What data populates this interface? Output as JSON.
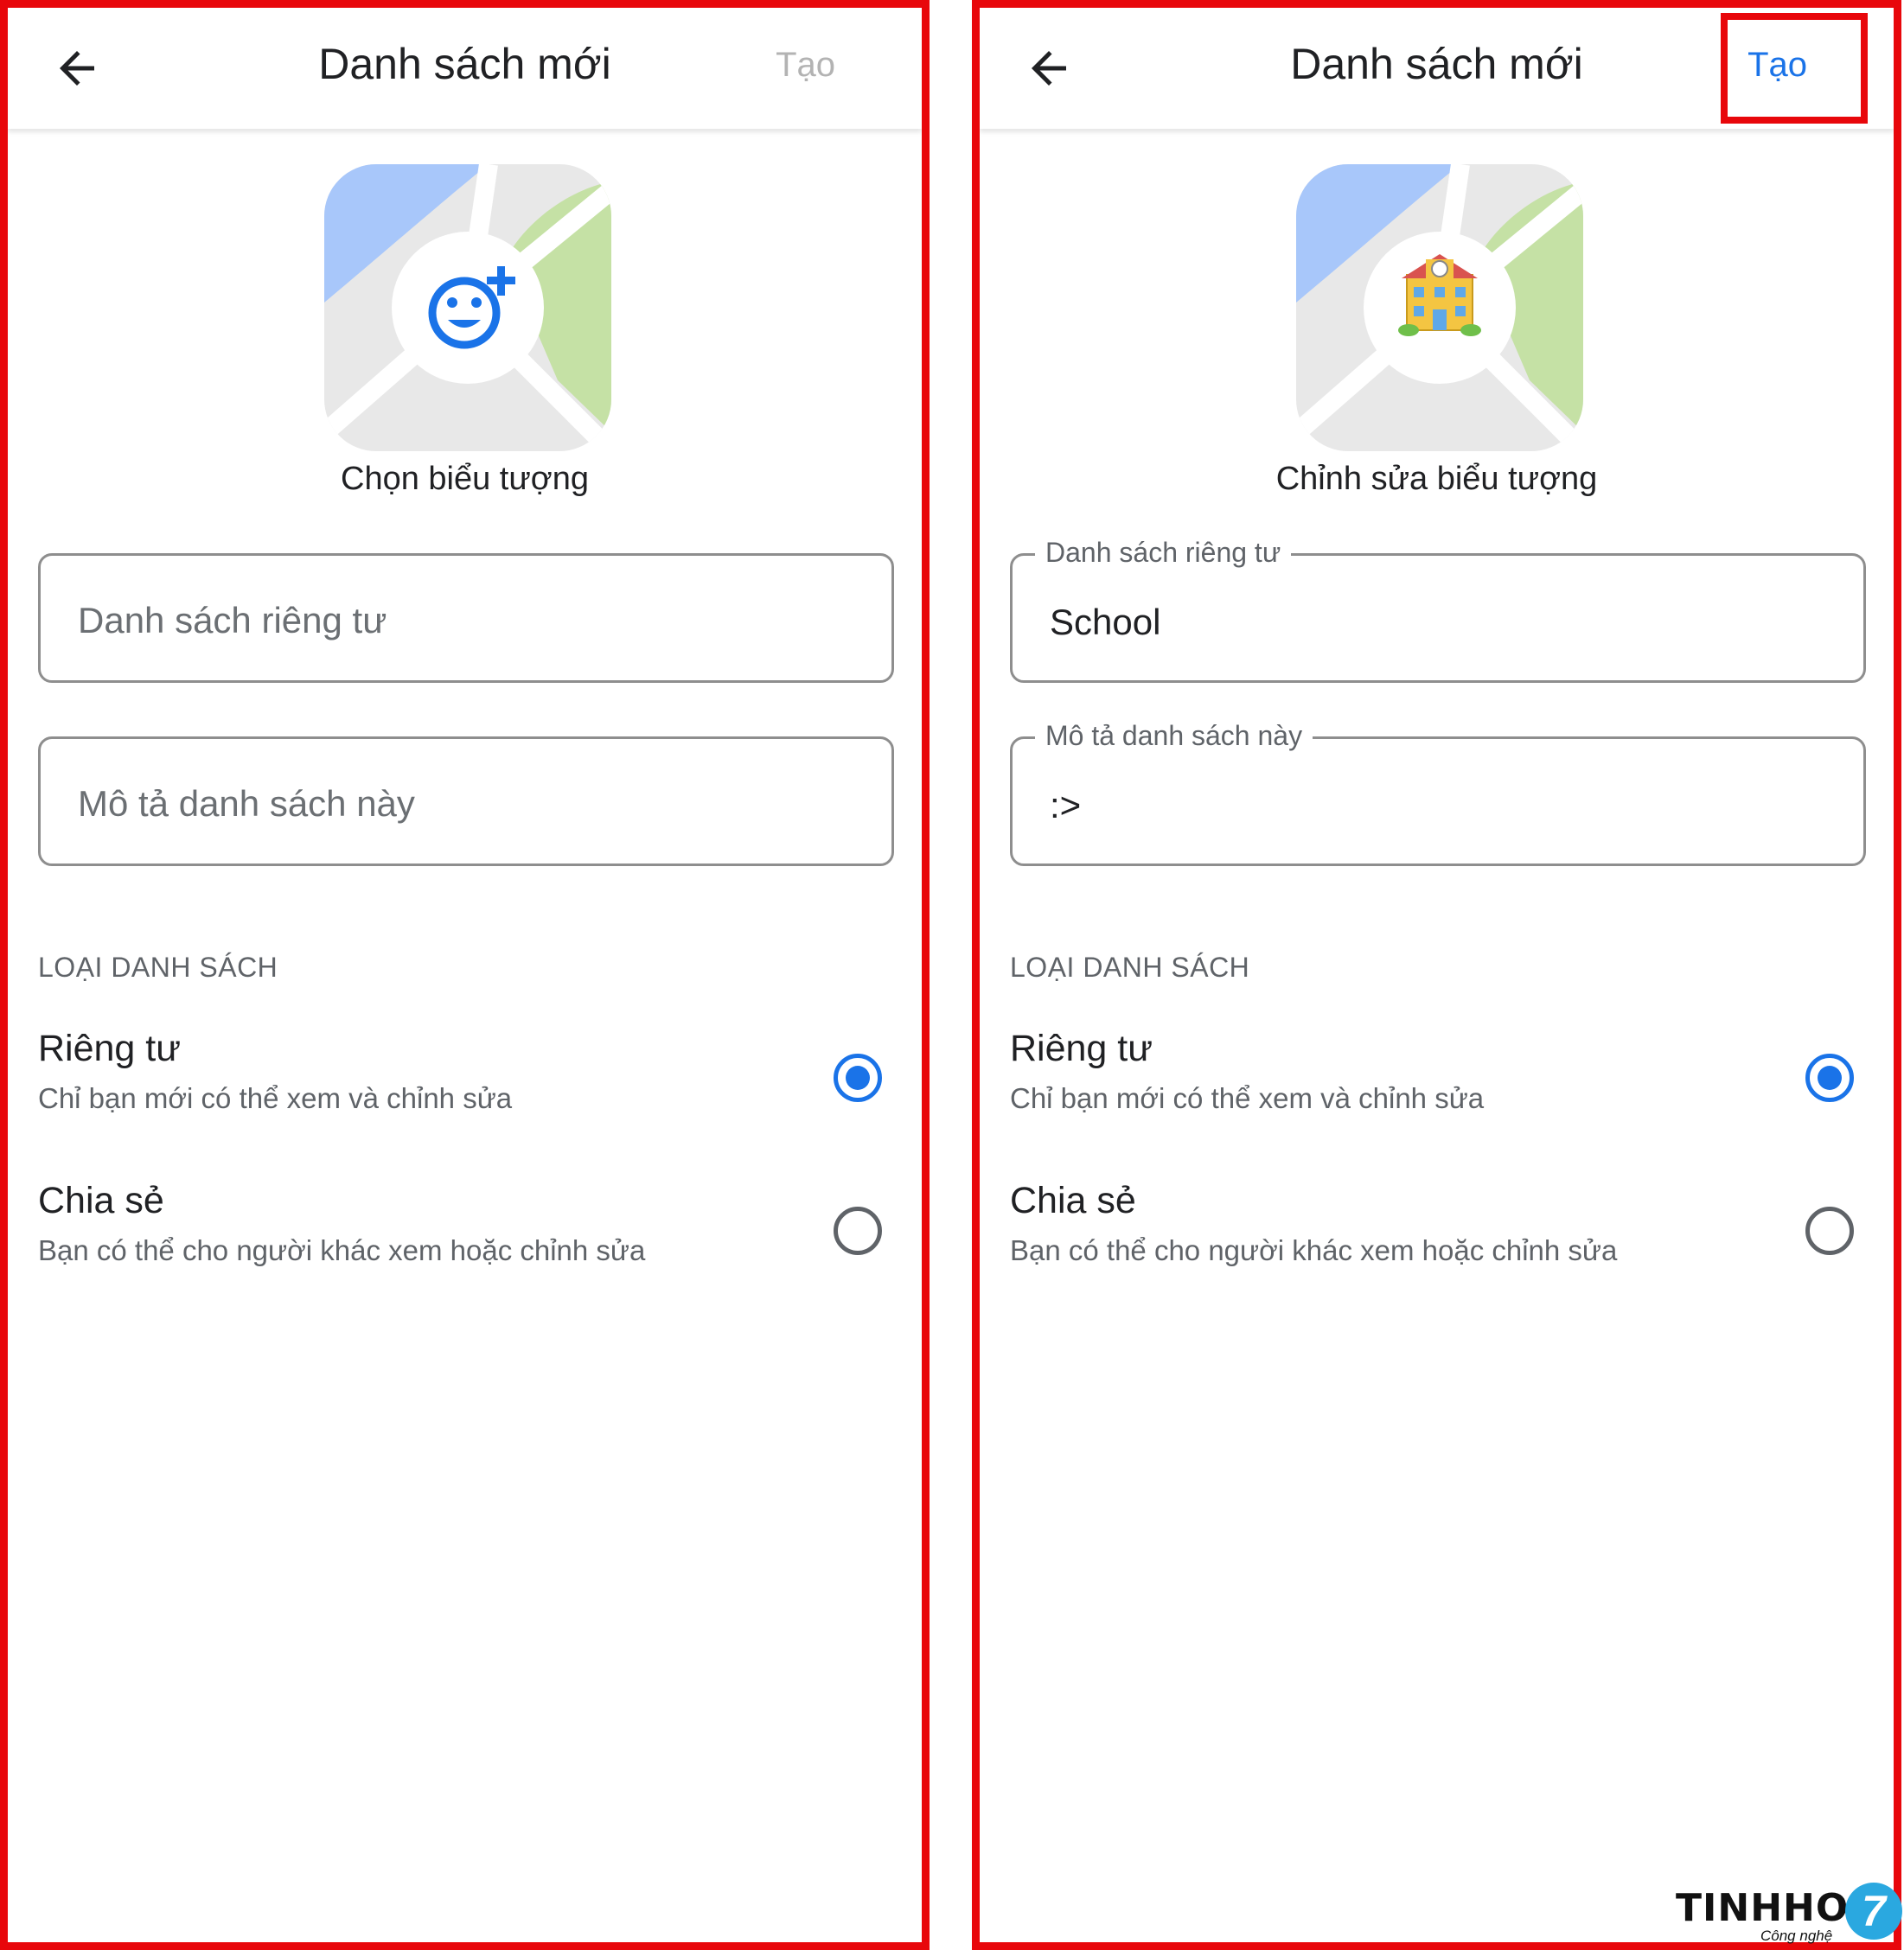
{
  "left": {
    "title": "Danh sách mới",
    "create_label": "Tạo",
    "icon_caption": "Chọn biểu tượng",
    "name_field": {
      "placeholder": "Danh sách riêng tư"
    },
    "desc_field": {
      "placeholder": "Mô tả danh sách này"
    },
    "section_label": "LOẠI DANH SÁCH",
    "options": [
      {
        "title": "Riêng tư",
        "subtitle": "Chỉ bạn mới có thể xem và chỉnh sửa",
        "selected": true
      },
      {
        "title": "Chia sẻ",
        "subtitle": "Bạn có thể cho người khác xem hoặc chỉnh sửa",
        "selected": false
      }
    ],
    "icon": "add-emoji-icon"
  },
  "right": {
    "title": "Danh sách mới",
    "create_label": "Tạo",
    "icon_caption": "Chỉnh sửa biểu tượng",
    "name_field": {
      "label": "Danh sách riêng tư",
      "value": "School"
    },
    "desc_field": {
      "label": "Mô tả danh sách này",
      "value": ":>"
    },
    "section_label": "LOẠI DANH SÁCH",
    "options": [
      {
        "title": "Riêng tư",
        "subtitle": "Chỉ bạn mới có thể xem và chỉnh sửa",
        "selected": true
      },
      {
        "title": "Chia sẻ",
        "subtitle": "Bạn có thể cho người khác xem hoặc chỉnh sửa",
        "selected": false
      }
    ],
    "icon": "school-emoji",
    "icon_glyph": "🏫"
  },
  "watermark": {
    "brand": "TINHHOA",
    "tagline": "Công nghệ",
    "mark": "7"
  },
  "colors": {
    "accent": "#1a73e8",
    "highlight": "#e8070b",
    "map_blue": "#a8c7fa",
    "map_green": "#c5e1a5",
    "map_gray": "#e8e8e8"
  }
}
